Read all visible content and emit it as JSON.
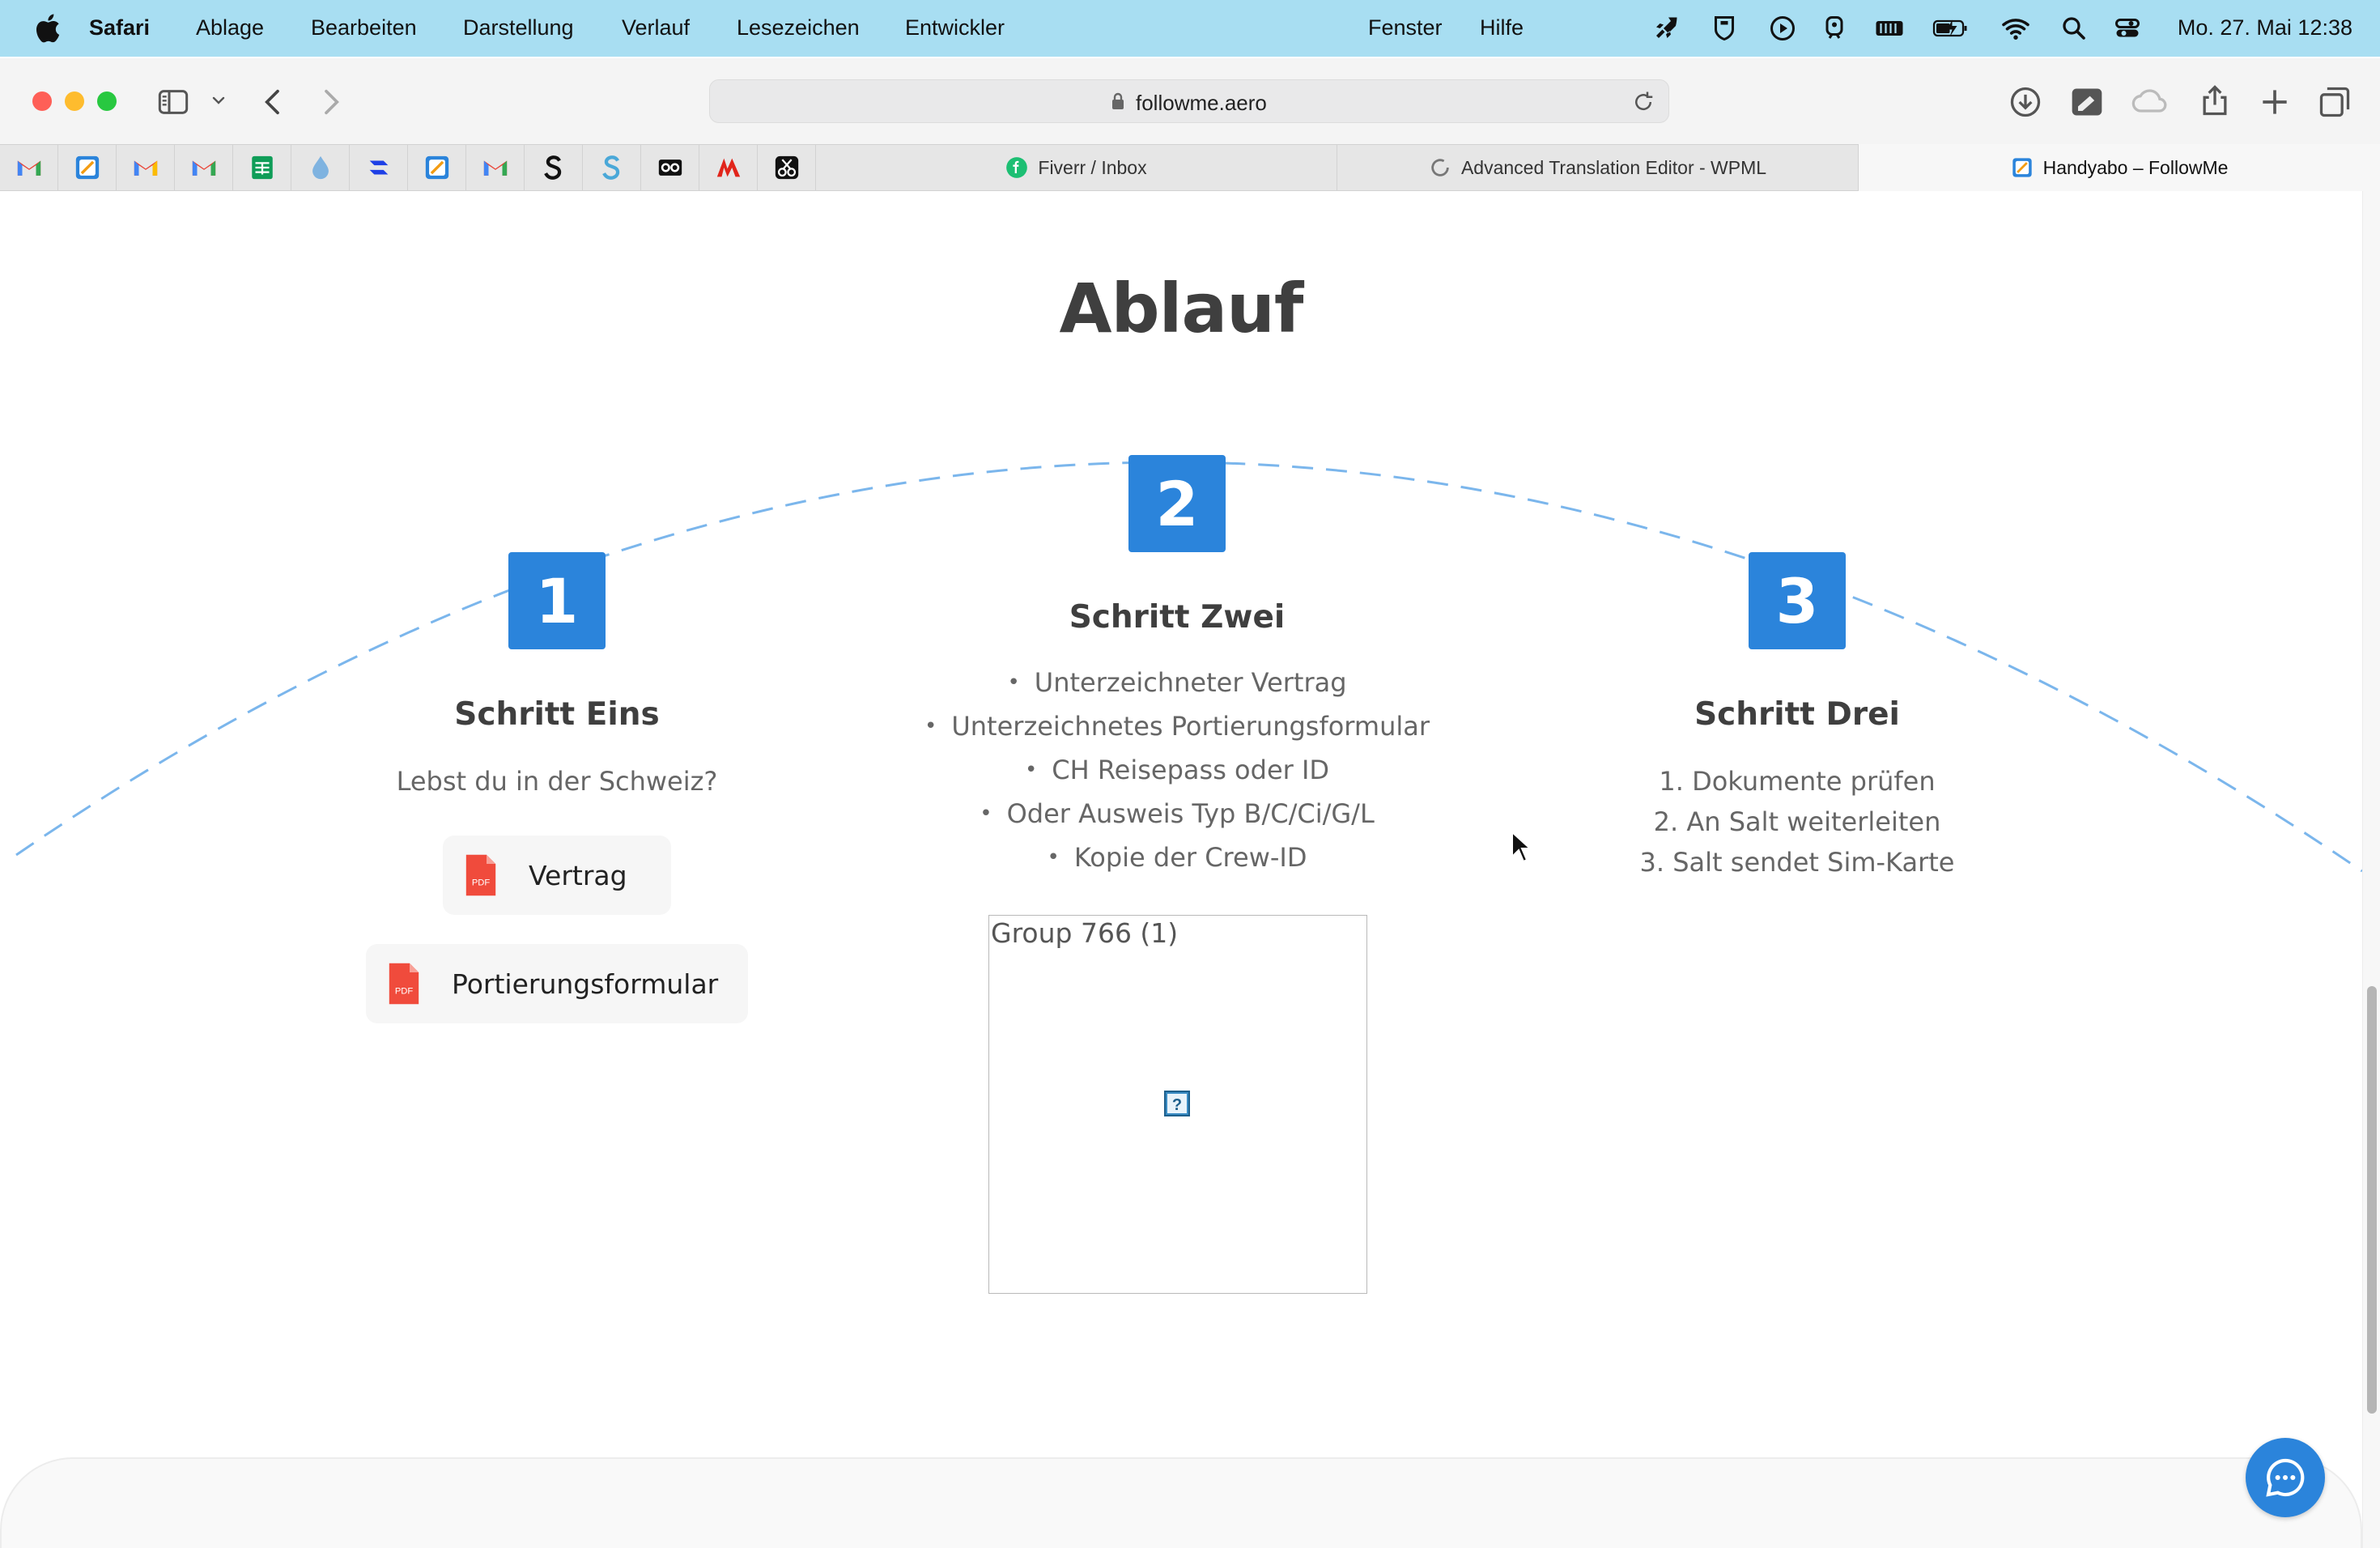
{
  "menubar": {
    "app_name": "Safari",
    "items": [
      "Ablage",
      "Bearbeiten",
      "Darstellung",
      "Verlauf",
      "Lesezeichen",
      "Entwickler",
      "Fenster",
      "Hilfe"
    ],
    "clock": "Mo. 27. Mai  12:38",
    "status_icons": [
      "rocket-icon",
      "shield-icon",
      "play-icon",
      "tram-icon",
      "memory-icon",
      "battery-charging-icon",
      "wifi-icon",
      "search-icon",
      "control-center-icon"
    ],
    "background": "#a8def2"
  },
  "browser": {
    "url": "followme.aero",
    "toolbar_icons": [
      "sidebar-icon",
      "chevron-down-icon",
      "back-icon",
      "forward-icon",
      "download-icon",
      "extension-icon",
      "icloud-icon",
      "share-icon",
      "new-tab-icon",
      "tab-overview-icon"
    ]
  },
  "tabs": {
    "pinned": [
      "gmail-icon",
      "followme-icon",
      "gmail-icon",
      "gmail-icon",
      "sheets-icon",
      "drop-icon",
      "r-icon",
      "followme-icon",
      "gmail-icon",
      "s-black-icon",
      "s-blue-icon",
      "glasses-icon",
      "m-red-icon",
      "scissors-icon"
    ],
    "open": [
      {
        "title": "Fiverr / Inbox",
        "icon": "fiverr-icon"
      },
      {
        "title": "Advanced Translation Editor - WPML",
        "icon": "loading-icon"
      },
      {
        "title": "Handyabo – FollowMe",
        "icon": "followme-icon"
      }
    ]
  },
  "page": {
    "title": "Ablauf",
    "accent_color": "#2b84db",
    "steps": [
      {
        "number": "1",
        "title": "Schritt Eins",
        "question": "Lebst du in der Schweiz?",
        "buttons": [
          "Vertrag",
          "Portierungsformular"
        ]
      },
      {
        "number": "2",
        "title": "Schritt Zwei",
        "bullets": [
          "Unterzeichneter Vertrag",
          "Unterzeichnetes Portierungsformular",
          "CH Reisepass oder ID",
          "Oder Ausweis Typ B/C/Ci/G/L",
          "Kopie der Crew-ID"
        ],
        "image_alt": "Group 766 (1)"
      },
      {
        "number": "3",
        "title": "Schritt Drei",
        "list": [
          "1. Dokumente prüfen",
          "2. An Salt weiterleiten",
          "3. Salt sendet Sim-Karte"
        ]
      }
    ],
    "pdf_badge": "PDF",
    "chat_icon": "chat-bubble-icon"
  }
}
